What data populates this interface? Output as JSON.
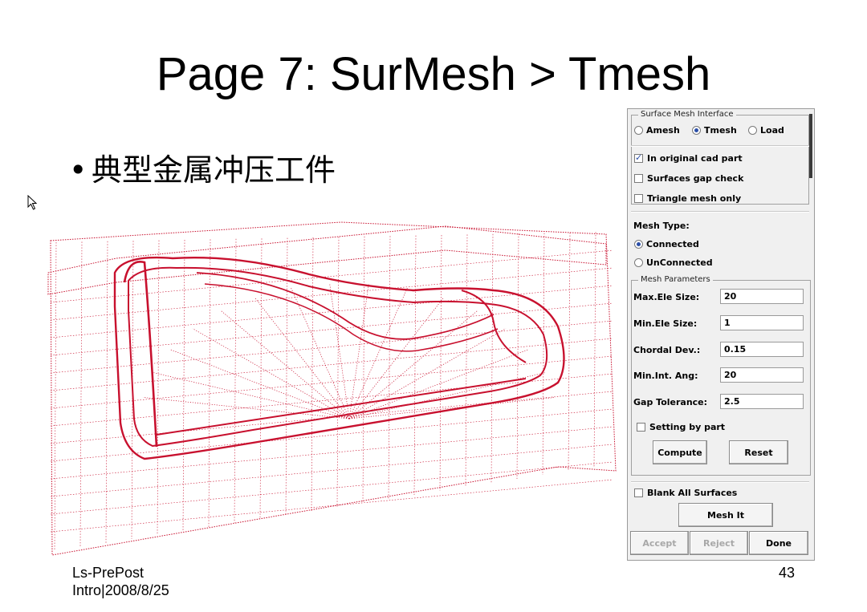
{
  "slide": {
    "title": "Page 7: SurMesh > Tmesh",
    "bullet_symbol": "•",
    "bullet_text": "典型金属冲压工件",
    "footer_left_line1": "Ls-PrePost",
    "footer_left_line2": "Intro|2008/8/25",
    "page_number": "43"
  },
  "colors": {
    "mesh": "#c8102e",
    "accent": "#2b4fa8"
  },
  "panel": {
    "title": "Surface Mesh Interface",
    "modes": [
      {
        "label": "Amesh",
        "selected": false
      },
      {
        "label": "Tmesh",
        "selected": true
      },
      {
        "label": "Load",
        "selected": false
      }
    ],
    "options": [
      {
        "label": "In original cad part",
        "checked": true
      },
      {
        "label": "Surfaces gap check",
        "checked": false
      },
      {
        "label": "Triangle mesh only",
        "checked": false
      }
    ],
    "mesh_type_label": "Mesh Type:",
    "mesh_types": [
      {
        "label": "Connected",
        "selected": true
      },
      {
        "label": "UnConnected",
        "selected": false
      }
    ],
    "params_title": "Mesh Parameters",
    "params": [
      {
        "label": "Max.Ele Size:",
        "value": "20"
      },
      {
        "label": "Min.Ele Size:",
        "value": "1"
      },
      {
        "label": "Chordal Dev.:",
        "value": "0.15"
      },
      {
        "label": "Min.Int. Ang:",
        "value": "20"
      },
      {
        "label": "Gap Tolerance:",
        "value": "2.5"
      }
    ],
    "setting_by_part": "Setting by part",
    "compute": "Compute",
    "reset": "Reset",
    "blank_all": "Blank All Surfaces",
    "mesh_it": "Mesh It",
    "accept": "Accept",
    "reject": "Reject",
    "done": "Done"
  }
}
